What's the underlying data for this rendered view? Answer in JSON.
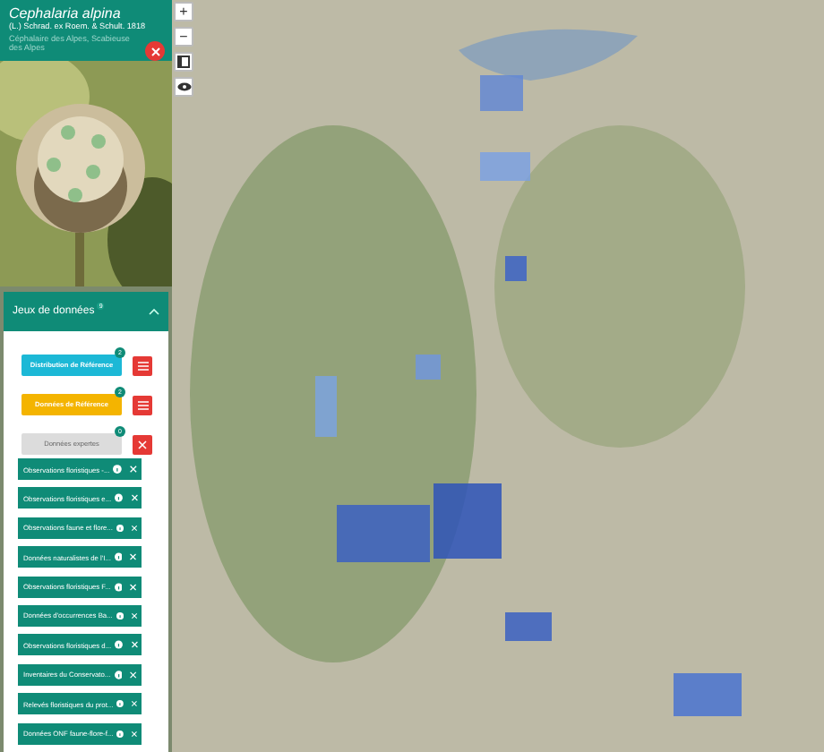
{
  "species": {
    "scientific_name": "Cephalaria alpina",
    "authority": "(L.) Schrad. ex Roem. & Schult. 1818",
    "common_names": "Céphalaire des Alpes, Scabieuse des Alpes"
  },
  "datasets": {
    "title": "Jeux de données",
    "count": "9",
    "expanded": true,
    "groups": [
      {
        "label": "Distribution de Référence",
        "badge": "2",
        "color": "#1cb8d6",
        "disabled": false,
        "kind": "list"
      },
      {
        "label": "Données de Référence",
        "badge": "2",
        "color": "#f4b400",
        "disabled": false,
        "kind": "list"
      },
      {
        "label": "Données expertes",
        "badge": "0",
        "color": "#dcdcdc",
        "disabled": true,
        "kind": "remove"
      }
    ],
    "items": [
      {
        "label": "Observations floristiques -..."
      },
      {
        "label": "Observations floristiques e..."
      },
      {
        "label": "Observations faune et flore..."
      },
      {
        "label": "Données naturalistes de l'I..."
      },
      {
        "label": "Observations floristiques F..."
      },
      {
        "label": "Données d'occurrences Ba..."
      },
      {
        "label": "Observations floristiques d..."
      },
      {
        "label": "Inventaires du Conservato..."
      },
      {
        "label": "Relevés floristiques du prot..."
      },
      {
        "label": "Données ONF faune-flore-f..."
      }
    ]
  },
  "map_controls": [
    {
      "kind": "zoom-in",
      "symbol": "+"
    },
    {
      "kind": "zoom-out",
      "symbol": "−"
    },
    {
      "kind": "layers"
    },
    {
      "kind": "visibility"
    }
  ]
}
